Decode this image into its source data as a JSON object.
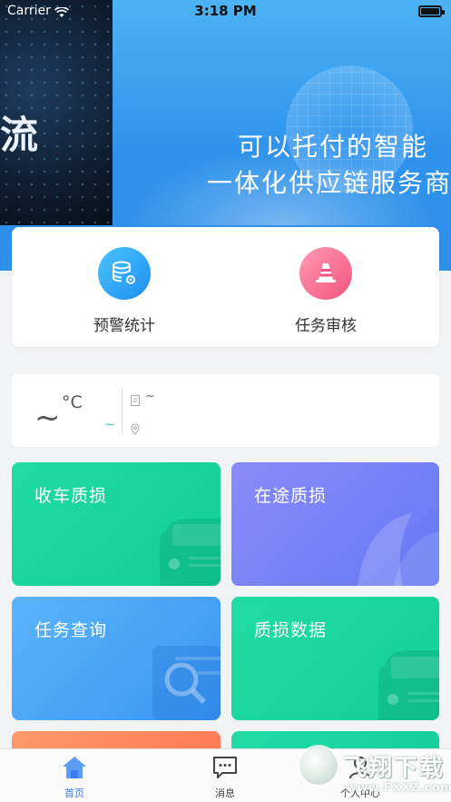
{
  "status_bar": {
    "carrier": "Carrier",
    "time": "3:18 PM"
  },
  "banner": {
    "left_glyph": "流",
    "line1": "可以托付的智能",
    "line2": "一体化供应链服务商"
  },
  "quick_actions": [
    {
      "label": "预警统计",
      "icon": "database-gear-icon"
    },
    {
      "label": "任务审核",
      "icon": "traffic-cone-icon"
    }
  ],
  "weather": {
    "temp": "~",
    "unit": "°C",
    "range": "~",
    "info": "~"
  },
  "tiles": [
    {
      "label": "收车质损",
      "icon": "car-icon"
    },
    {
      "label": "在途质损",
      "icon": "leaf-icon"
    },
    {
      "label": "任务查询",
      "icon": "search-icon"
    },
    {
      "label": "质损数据",
      "icon": "car-icon"
    }
  ],
  "tabbar": {
    "items": [
      {
        "label": "首页",
        "icon": "home-icon",
        "active": true
      },
      {
        "label": "消息",
        "icon": "message-icon",
        "active": false
      },
      {
        "label": "个人中心",
        "icon": "user-icon",
        "active": false
      }
    ]
  },
  "watermark": {
    "brand": "飞翔下载",
    "url": "www.FXXZ.com"
  },
  "colors": {
    "accent": "#3b7df3",
    "green": "#12cf98",
    "purple": "#6678f4",
    "blue": "#3a95f4"
  }
}
